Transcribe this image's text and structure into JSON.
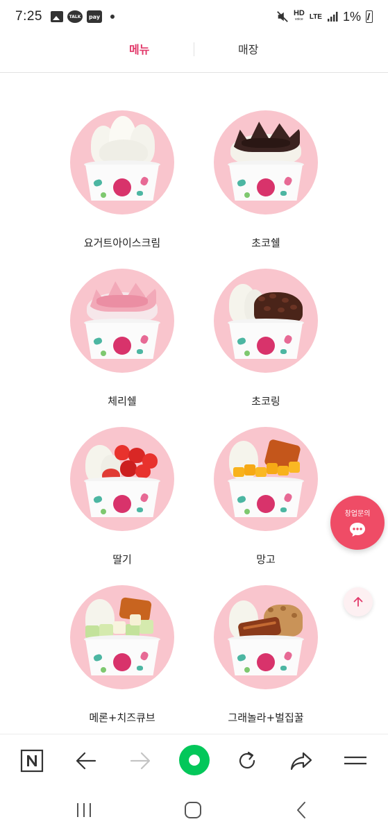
{
  "status_bar": {
    "time": "7:25",
    "notification_icons": [
      "gallery-icon",
      "talk-icon",
      "pay-icon"
    ],
    "talk_text": "TALK",
    "pay_text": "pay",
    "hd_text": "HD",
    "hd_sub": "voice",
    "lte_text": "LTE",
    "battery_percent": "1%"
  },
  "tabs": [
    {
      "label": "메뉴",
      "active": true
    },
    {
      "label": "매장",
      "active": false
    }
  ],
  "menu_items": [
    {
      "name": "요거트아이스크림",
      "topping": "plain"
    },
    {
      "name": "초코쉘",
      "topping": "choco-shell"
    },
    {
      "name": "체리쉘",
      "topping": "cherry-shell"
    },
    {
      "name": "초코링",
      "topping": "choco-ring"
    },
    {
      "name": "딸기",
      "topping": "strawberry"
    },
    {
      "name": "망고",
      "topping": "mango"
    },
    {
      "name": "메론+치즈큐브",
      "topping": "melon-cheese"
    },
    {
      "name": "그래놀라+벌집꿀",
      "topping": "granola-honeycomb"
    }
  ],
  "chat_fab": {
    "label": "창업문의"
  },
  "colors": {
    "accent": "#e23a6b",
    "circle_bg": "#f9c5cd",
    "fab": "#ef4c66",
    "naver_green": "#03c75a"
  },
  "browser_toolbar": {
    "buttons": [
      "naver-icon",
      "back-arrow-icon",
      "forward-arrow-icon",
      "home-icon",
      "reload-icon",
      "share-icon",
      "menu-icon"
    ]
  },
  "system_nav": {
    "buttons": [
      "recents-icon",
      "home-icon",
      "back-icon"
    ]
  }
}
